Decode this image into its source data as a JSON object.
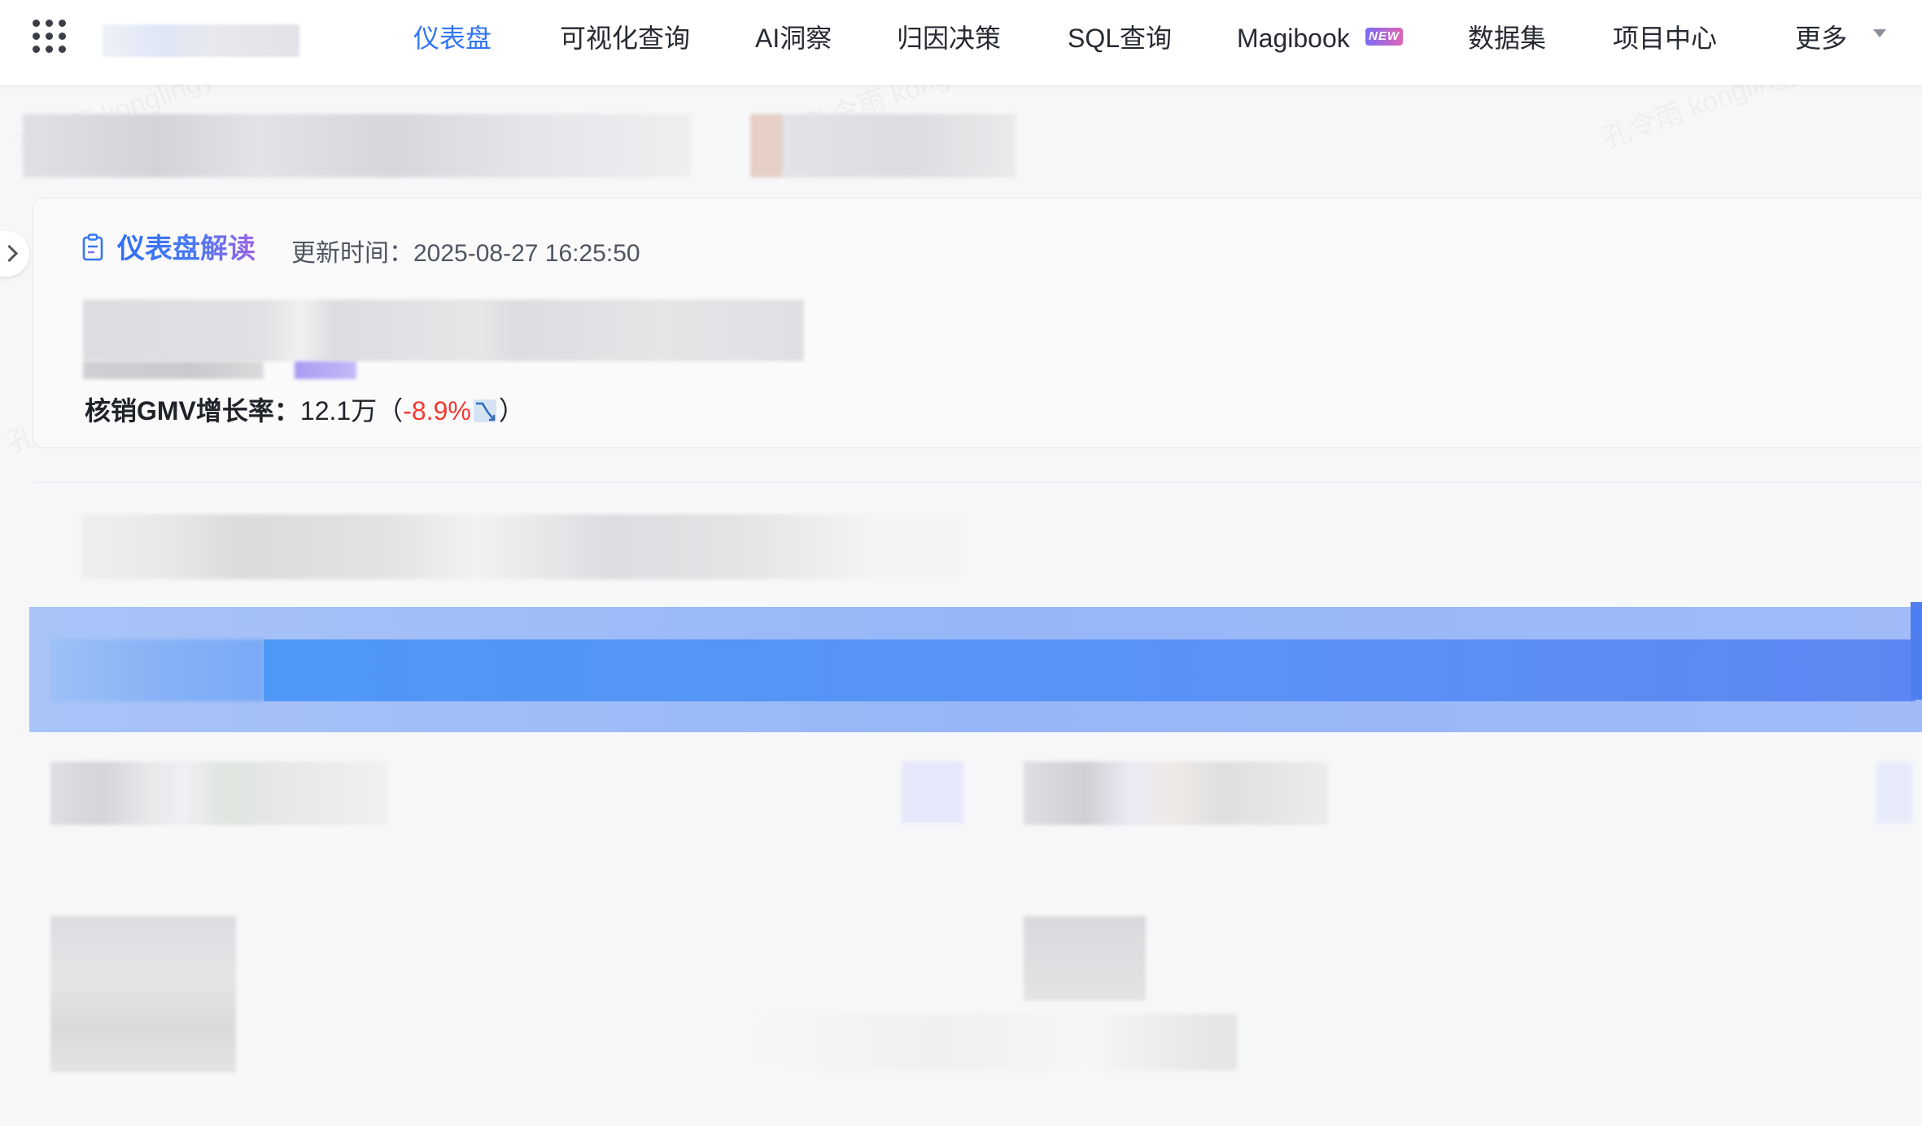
{
  "nav": {
    "items": [
      {
        "label": "仪表盘",
        "active": true
      },
      {
        "label": "可视化查询"
      },
      {
        "label": "AI洞察"
      },
      {
        "label": "归因决策"
      },
      {
        "label": "SQL查询"
      },
      {
        "label": "Magibook",
        "badge": "NEW"
      },
      {
        "label": "数据集"
      },
      {
        "label": "项目中心"
      },
      {
        "label": "更多"
      }
    ]
  },
  "summary": {
    "title": "仪表盘解读",
    "update_time": "更新时间：2025-08-27 16:25:50",
    "metric": {
      "label": "核销GMV增长率：",
      "value": "12.1万",
      "open_paren": "（",
      "change": "-8.9%",
      "close_paren": "）",
      "trend": "down"
    }
  },
  "watermark": "孔令雨 konglingyu.326",
  "colors": {
    "accent": "#3475f5",
    "negative": "#f13a32",
    "band": "#5a92f6"
  },
  "icons": {
    "apps": "apps-grid-icon",
    "expand": "chevron-right-icon",
    "summary": "clipboard-icon",
    "trend": "trend-down-icon",
    "more": "caret-down-icon"
  }
}
